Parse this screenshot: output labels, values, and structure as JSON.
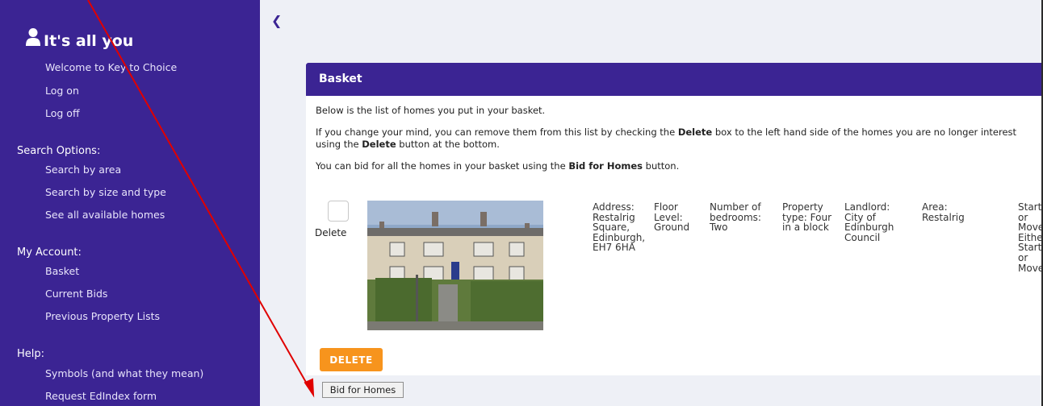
{
  "sidebar": {
    "title": "It's all you",
    "user_icon": "user-icon",
    "links_top": [
      "Welcome to Key to Choice",
      "Log on",
      "Log off"
    ],
    "search_heading": "Search Options:",
    "search_links": [
      "Search by area",
      "Search by size and type",
      "See all available homes"
    ],
    "account_heading": "My Account:",
    "account_links": [
      "Basket",
      "Current Bids",
      "Previous Property Lists"
    ],
    "help_heading": "Help:",
    "help_links": [
      "Symbols (and what they mean)",
      "Request EdIndex form"
    ]
  },
  "main": {
    "back_icon": "chevron-left-icon",
    "panel_title": "Basket",
    "intro": "Below is the list of homes you put in your basket.",
    "remove_1a": "If you change your mind, you can remove them from this list by checking the ",
    "remove_1b": "Delete",
    "remove_1c": " box to the left hand side of the homes you are no longer interest",
    "remove_2a": "using the ",
    "remove_2b": "Delete",
    "remove_2c": " button at the bottom.",
    "bid_a": "You can bid for all the homes in your basket using the ",
    "bid_b": "Bid for Homes",
    "bid_c": " button.",
    "delete_label": "Delete",
    "property": {
      "address": "Address: Restalrig Square, Edinburgh, EH7 6HA",
      "floor": "Floor Level: Ground",
      "bedrooms": "Number of bedrooms: Two",
      "type": "Property type: Four in a block",
      "landlord": "Landlord: City of Edinburgh Council",
      "area": "Area: Restalrig",
      "start": "Start or Move Eithe Start or Move"
    },
    "delete_button": "DELETE",
    "bid_button": "Bid for Homes"
  },
  "colors": {
    "sidebar": "#3b2493",
    "header": "#3b2493",
    "delete_button": "#f7941d",
    "annotation_arrow": "#e00000"
  }
}
